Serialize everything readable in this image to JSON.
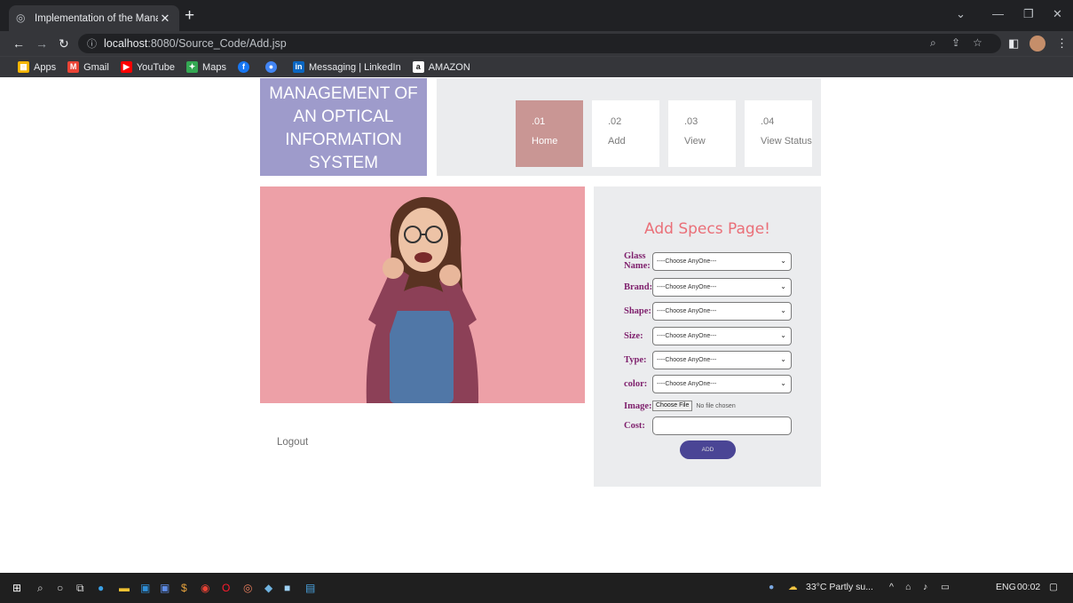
{
  "browser": {
    "tab_title": "Implementation of the Managem",
    "tab_close": "✕",
    "new_tab": "+",
    "url_host": "localhost",
    "url_path": ":8080/Source_Code/Add.jsp",
    "bookmarks": [
      {
        "label": "Apps",
        "icon": "apps-grid-icon",
        "color": "#f4b400"
      },
      {
        "label": "Gmail",
        "icon": "gmail-icon",
        "color": "#ea4335"
      },
      {
        "label": "YouTube",
        "icon": "youtube-icon",
        "color": "#ff0000"
      },
      {
        "label": "Maps",
        "icon": "maps-icon",
        "color": "#34a853"
      },
      {
        "label": "",
        "icon": "facebook-icon",
        "color": "#1877f2"
      },
      {
        "label": "",
        "icon": "chrome-icon",
        "color": "#4285f4"
      },
      {
        "label": "Messaging | LinkedIn",
        "icon": "linkedin-icon",
        "color": "#0a66c2"
      },
      {
        "label": "AMAZON",
        "icon": "amazon-icon",
        "color": "#ffffff"
      }
    ]
  },
  "site": {
    "logo_text": "MANAGEMENT OF AN OPTICAL INFORMATION SYSTEM",
    "colors": {
      "logo_bg": "#9e9bcb",
      "active_menu": "#c99694",
      "title": "#ea6f78",
      "label": "#7e1f6c",
      "add_button": "#4a4595"
    },
    "menu": [
      {
        "num": ".01",
        "label": "Home",
        "active": true
      },
      {
        "num": ".02",
        "label": "Add",
        "active": false
      },
      {
        "num": ".03",
        "label": "View",
        "active": false
      },
      {
        "num": ".04",
        "label": "View Status",
        "active": false
      }
    ],
    "logout": "Logout"
  },
  "form": {
    "title": "Add Specs Page!",
    "fields": {
      "glass_name": {
        "label": "Glass Name:",
        "value": "----Choose AnyOne---"
      },
      "brand": {
        "label": "Brand:",
        "value": "----Choose AnyOne---"
      },
      "shape": {
        "label": "Shape:",
        "value": "----Choose AnyOne---"
      },
      "size": {
        "label": "Size:",
        "value": "----Choose AnyOne---"
      },
      "type": {
        "label": "Type:",
        "value": "----Choose AnyOne---"
      },
      "color": {
        "label": "color:",
        "value": "----Choose AnyOne---"
      }
    },
    "image": {
      "label": "Image:",
      "button": "Choose File",
      "status": "No file chosen"
    },
    "cost": {
      "label": "Cost:",
      "value": ""
    },
    "submit": "ADD"
  },
  "taskbar": {
    "weather": "33°C  Partly su...",
    "lang": "ENG",
    "time": "00:02"
  }
}
